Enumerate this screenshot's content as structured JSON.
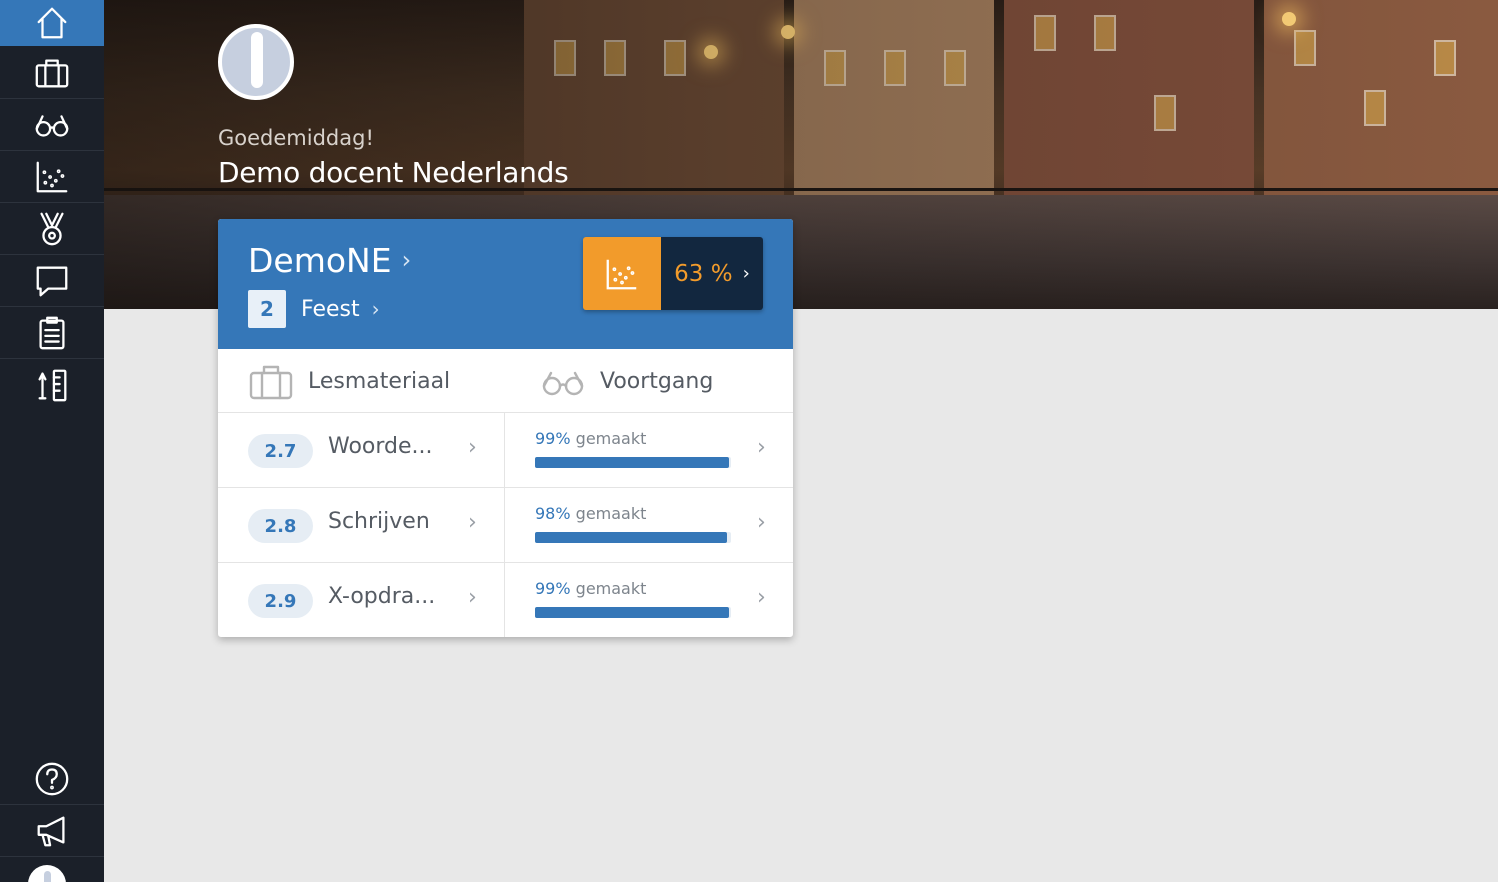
{
  "header": {
    "greeting": "Goedemiddag!",
    "username": "Demo docent Nederlands"
  },
  "card": {
    "course": "DemoNE",
    "chapter_number": "2",
    "chapter_name": "Feest",
    "score": "63 %",
    "columns": {
      "material": "Lesmateriaal",
      "progress": "Voortgang"
    },
    "progress_suffix": "gemaakt",
    "rows": [
      {
        "number": "2.7",
        "name": "Woorde...",
        "percent": "99%",
        "fill": 0.99
      },
      {
        "number": "2.8",
        "name": "Schrijven",
        "percent": "98%",
        "fill": 0.98
      },
      {
        "number": "2.9",
        "name": "X-opdra...",
        "percent": "99%",
        "fill": 0.99
      }
    ]
  },
  "sidebar": {
    "icons": [
      "home-icon",
      "briefcase-icon",
      "glasses-icon",
      "scatter-chart-icon",
      "medal-icon",
      "chat-icon",
      "clipboard-icon",
      "tools-icon",
      "help-icon",
      "megaphone-icon"
    ]
  },
  "colors": {
    "primary": "#3577b8",
    "accent": "#f29b2b",
    "sidebar": "#1b2029",
    "score_bg": "#12273f"
  }
}
